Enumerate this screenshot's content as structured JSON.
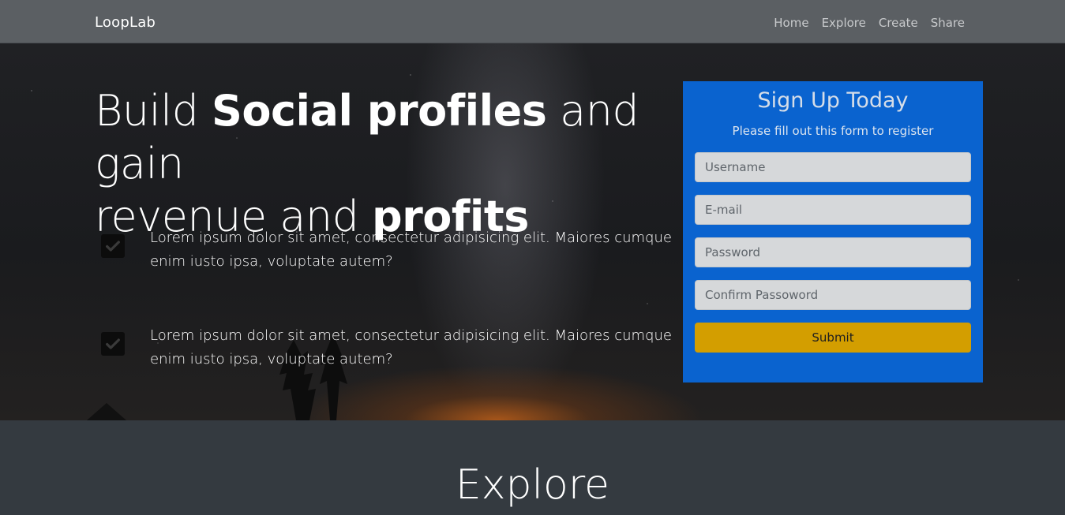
{
  "navbar": {
    "brand": "LoopLab",
    "links": [
      "Home",
      "Explore",
      "Create",
      "Share"
    ]
  },
  "hero": {
    "headline_parts": [
      "Build ",
      "Social profiles",
      " and gain ",
      "revenue and ",
      "profits"
    ],
    "features": [
      {
        "text": "Lorem ipsum dolor sit amet, consectetur adipisicing elit. Maiores cumque enim iusto ipsa, voluptate autem?",
        "icon": "check-icon"
      },
      {
        "text": "Lorem ipsum dolor sit amet, consectetur adipisicing elit. Maiores cumque enim iusto ipsa, voluptate autem?",
        "icon": "check-icon"
      }
    ]
  },
  "signup": {
    "title": "Sign Up Today",
    "subtitle": "Please fill out this form to register",
    "username_placeholder": "Username",
    "email_placeholder": "E-mail",
    "password_placeholder": "Password",
    "confirm_placeholder": "Confirm Passoword",
    "submit_label": "Submit"
  },
  "explore": {
    "title": "Explore"
  },
  "colors": {
    "navbar_bg": "#5b5f63",
    "card_bg": "#0a63cf",
    "submit_bg": "#d39e00",
    "section_bg": "#343a40"
  }
}
